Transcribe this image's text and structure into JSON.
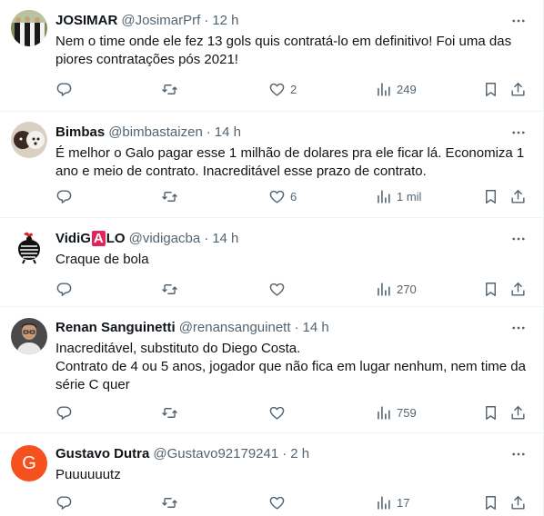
{
  "tweets": [
    {
      "name": "JOSIMAR",
      "handle": "@JosimarPrf",
      "separator": "·",
      "time": "12 h",
      "text": "Nem o time onde ele fez 13 gols quis contratá-lo em definitivo! Foi uma das piores contratações pós 2021!",
      "replies": "",
      "retweets": "",
      "likes": "2",
      "views": "249",
      "avatar_icon": "team-photo-avatar"
    },
    {
      "name": "Bimbas",
      "handle": "@bimbastaizen",
      "separator": "·",
      "time": "14 h",
      "text": "É melhor o Galo pagar esse 1 milhão de dolares pra ele ficar lá. Economiza 1 ano e meio de contrato. Inacreditável esse prazo de contrato.",
      "replies": "",
      "retweets": "",
      "likes": "6",
      "views": "1 mil",
      "avatar_icon": "dog-photo-avatar"
    },
    {
      "name_part1": "VidiG",
      "name_part2": "A",
      "name_part3": "LO",
      "handle": "@vidigacba",
      "separator": "·",
      "time": "14 h",
      "text": "Craque de bola",
      "replies": "",
      "retweets": "",
      "likes": "",
      "views": "270",
      "avatar_icon": "rooster-logo-avatar"
    },
    {
      "name": "Renan Sanguinetti",
      "handle": "@renansanguinett",
      "separator": "·",
      "time": "14 h",
      "text": "Inacreditável, substituto do Diego Costa.\nContrato de 4 ou 5 anos, jogador que não fica em lugar nenhum, nem time da série C quer",
      "replies": "",
      "retweets": "",
      "likes": "",
      "views": "759",
      "avatar_icon": "person-photo-avatar"
    },
    {
      "name": "Gustavo Dutra",
      "handle": "@Gustavo92179241",
      "separator": "·",
      "time": "2 h",
      "text": "Puuuuuutz",
      "avatar_letter": "G",
      "replies": "",
      "retweets": "",
      "likes": "",
      "views": "17",
      "avatar_icon": "letter-avatar"
    }
  ],
  "colors": {
    "text": "#0f1419",
    "secondary": "#536471",
    "divider": "#eff3f4",
    "letter_avatar_bg": "#f4511e",
    "brand_badge": "#e0245e"
  }
}
